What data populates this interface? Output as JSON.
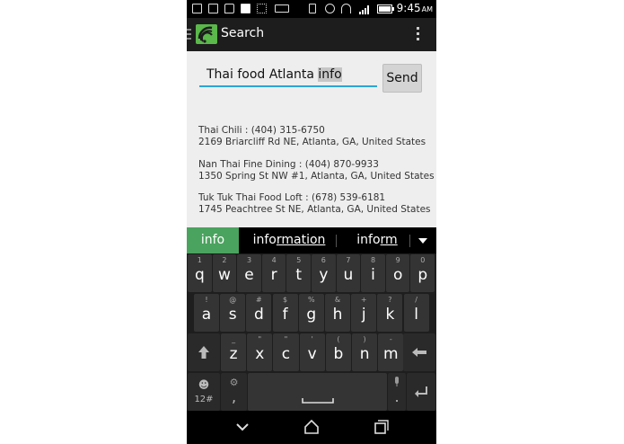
{
  "status_bar": {
    "time": "9:45",
    "ampm": "AM",
    "icons": [
      "notification-icon",
      "image-icon",
      "message-icon",
      "facebook-icon",
      "dots-icon",
      "keyboard-icon",
      "vibrate-icon",
      "alarm-icon",
      "wifi-icon",
      "signal-icon",
      "battery-icon"
    ]
  },
  "action_bar": {
    "title": "Search",
    "app_icon": "wifi-search-app-icon"
  },
  "search": {
    "query_prefix": "Thai food Atlanta ",
    "query_selected": "info",
    "send_label": "Send"
  },
  "results": [
    {
      "line1": "Thai Chili : (404) 315-6750",
      "line2": "2169 Briarcliff Rd NE, Atlanta, GA, United States"
    },
    {
      "line1": "Nan Thai Fine Dining : (404) 870-9933",
      "line2": "1350 Spring St NW #1, Atlanta, GA, United States"
    },
    {
      "line1": "Tuk Tuk Thai Food Loft : (678) 539-6181",
      "line2": "1745 Peachtree St NE, Atlanta, GA, United States"
    }
  ],
  "suggestions": {
    "s1": "info",
    "s2_plain": "info",
    "s2_under": "rmation",
    "s3_plain": "info",
    "s3_under": "rm"
  },
  "keyboard": {
    "row1": [
      {
        "main": "q",
        "alt": "1"
      },
      {
        "main": "w",
        "alt": "2"
      },
      {
        "main": "e",
        "alt": "3"
      },
      {
        "main": "r",
        "alt": "4"
      },
      {
        "main": "t",
        "alt": "5"
      },
      {
        "main": "y",
        "alt": "6"
      },
      {
        "main": "u",
        "alt": "7"
      },
      {
        "main": "i",
        "alt": "8"
      },
      {
        "main": "o",
        "alt": "9"
      },
      {
        "main": "p",
        "alt": "0"
      }
    ],
    "row2": [
      {
        "main": "a",
        "alt": "!"
      },
      {
        "main": "s",
        "alt": "@"
      },
      {
        "main": "d",
        "alt": "#"
      },
      {
        "main": "f",
        "alt": "$"
      },
      {
        "main": "g",
        "alt": "%"
      },
      {
        "main": "h",
        "alt": "&"
      },
      {
        "main": "j",
        "alt": "+"
      },
      {
        "main": "k",
        "alt": "?"
      },
      {
        "main": "l",
        "alt": "/"
      }
    ],
    "row3": [
      {
        "main": "z",
        "alt": "_"
      },
      {
        "main": "x",
        "alt": "\""
      },
      {
        "main": "c",
        "alt": "\""
      },
      {
        "main": "v",
        "alt": "'"
      },
      {
        "main": "b",
        "alt": "("
      },
      {
        "main": "n",
        "alt": ")"
      },
      {
        "main": "m",
        "alt": "-"
      }
    ],
    "row4": {
      "sym_label": "12#",
      "comma": ",",
      "period": "."
    }
  },
  "navbar": {
    "back": "back-icon",
    "home": "home-icon",
    "recents": "recents-icon"
  }
}
